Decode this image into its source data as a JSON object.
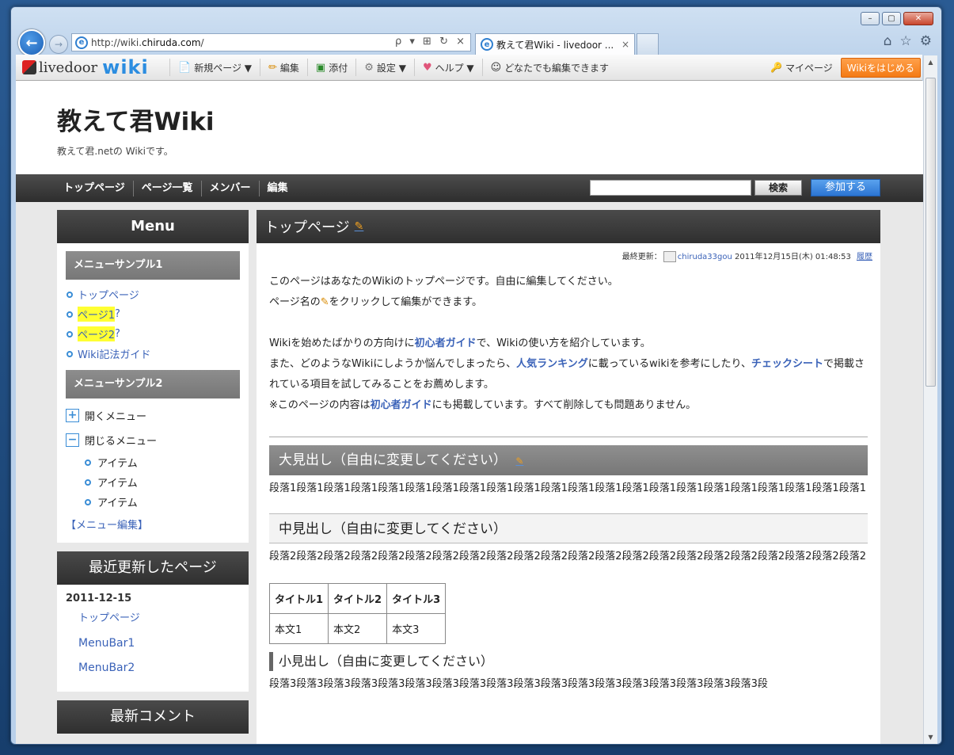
{
  "browser": {
    "url_prefix": "http://wiki.",
    "url_host": "chiruda.com",
    "url_suffix": "/",
    "tab_title": "教えて君Wiki - livedoor ...",
    "tab_close": "×",
    "url_tools": "ρ ▾ ⊞ ↻ ×"
  },
  "window_controls": {
    "minimize": "–",
    "maximize": "▢",
    "close": "✕"
  },
  "livedoor_bar": {
    "logo_text": "livedoor",
    "logo_wiki": "wiki",
    "items": [
      {
        "icon": "📄",
        "label": "新規ページ ▼"
      },
      {
        "icon": "✏",
        "label": "編集"
      },
      {
        "icon": "▣",
        "label": "添付"
      },
      {
        "icon": "⚙",
        "label": "設定 ▼"
      },
      {
        "icon": "♥",
        "label": "ヘルプ ▼"
      },
      {
        "icon": "☺",
        "label": "どなたでも編集できます"
      }
    ],
    "mypage": "マイページ",
    "start_button": "Wikiをはじめる"
  },
  "site": {
    "title": "教えて君Wiki",
    "subtitle": "教えて君.netの Wikiです。"
  },
  "nav": {
    "links": [
      "トップページ",
      "ページ一覧",
      "メンバー",
      "編集"
    ],
    "search_button": "検索",
    "join_button": "参加する"
  },
  "sidebar": {
    "menu_title": "Menu",
    "sample1": "メニューサンプル1",
    "sample1_links": [
      {
        "text": "トップページ",
        "highlight": false,
        "q": ""
      },
      {
        "text": "ページ1",
        "highlight": true,
        "q": "?"
      },
      {
        "text": "ページ2",
        "highlight": true,
        "q": "?"
      },
      {
        "text": "Wiki記法ガイド",
        "highlight": false,
        "q": ""
      }
    ],
    "sample2": "メニューサンプル2",
    "open_menu": "開くメニュー",
    "close_menu": "閉じるメニュー",
    "items": [
      "アイテム",
      "アイテム",
      "アイテム"
    ],
    "menu_edit": "【メニュー編集】",
    "recent_title": "最近更新したページ",
    "recent_date": "2011-12-15",
    "recent_links": [
      "トップページ",
      "MenuBar1",
      "MenuBar2"
    ],
    "comments_title": "最新コメント"
  },
  "main": {
    "page_title": "トップページ",
    "lastmod_label": "最終更新：",
    "lastmod_user": "chiruda33gou",
    "lastmod_date": "2011年12月15日(木) 01:48:53",
    "history": "履歴",
    "p1": "このページはあなたのWikiのトップページです。自由に編集してください。",
    "p2a": "ページ名の",
    "p2b": "をクリックして編集ができます。",
    "p3a": "Wikiを始めたばかりの方向けに",
    "p3link": "初心者ガイド",
    "p3b": "で、Wikiの使い方を紹介しています。",
    "p4a": "また、どのようなWikiにしようか悩んでしまったら、",
    "p4link1": "人気ランキング",
    "p4b": "に載っているwikiを参考にしたり、",
    "p4link2": "チェックシート",
    "p4c": "で掲載されている項目を試してみることをお薦めします。",
    "p5a": "※このページの内容は",
    "p5link": "初心者ガイド",
    "p5b": "にも掲載しています。すべて削除しても問題ありません。",
    "h_large": "大見出し（自由に変更してください）",
    "para1": "段落1段落1段落1段落1段落1段落1段落1段落1段落1段落1段落1段落1段落1段落1段落1段落1段落1段落1段落1段落1段落1段落1",
    "h_mid": "中見出し（自由に変更してください）",
    "para2": "段落2段落2段落2段落2段落2段落2段落2段落2段落2段落2段落2段落2段落2段落2段落2段落2段落2段落2段落2段落2段落2段落2",
    "table": [
      [
        "タイトル1",
        "タイトル2",
        "タイトル3"
      ],
      [
        "本文1",
        "本文2",
        "本文3"
      ]
    ],
    "h_small": "小見出し（自由に変更してください）",
    "para3": "段落3段落3段落3段落3段落3段落3段落3段落3段落3段落3段落3段落3段落3段落3段落3段落3段落3段落3段"
  }
}
